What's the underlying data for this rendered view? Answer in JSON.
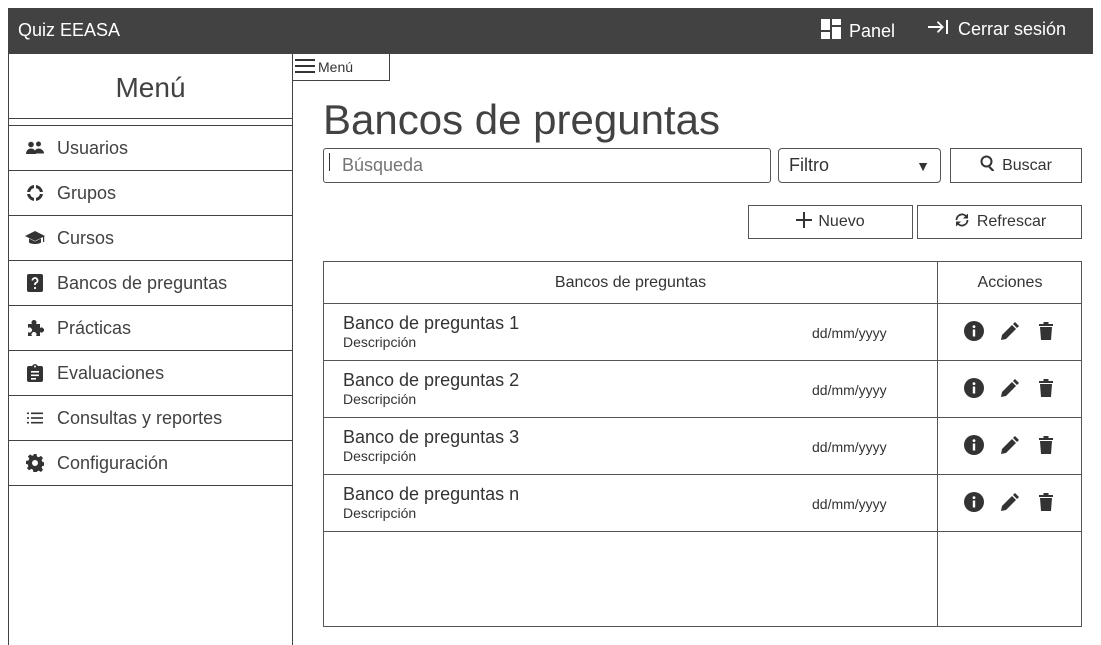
{
  "topbar": {
    "title": "Quiz EEASA",
    "panel_label": "Panel",
    "logout_label": "Cerrar sesión"
  },
  "sidebar": {
    "title": "Menú",
    "items": [
      {
        "label": "Usuarios",
        "icon": "users-icon"
      },
      {
        "label": "Grupos",
        "icon": "groups-icon"
      },
      {
        "label": "Cursos",
        "icon": "graduation-cap-icon"
      },
      {
        "label": "Bancos de preguntas",
        "icon": "question-icon"
      },
      {
        "label": "Prácticas",
        "icon": "puzzle-icon"
      },
      {
        "label": "Evaluaciones",
        "icon": "clipboard-icon"
      },
      {
        "label": "Consultas y reportes",
        "icon": "list-icon"
      },
      {
        "label": "Configuración",
        "icon": "gear-icon"
      }
    ]
  },
  "menu_toggle": {
    "label": "Menú"
  },
  "main": {
    "title": "Bancos de preguntas",
    "search": {
      "placeholder": "Búsqueda"
    },
    "filter": {
      "selected": "Filtro"
    },
    "search_button": "Buscar",
    "new_button": "Nuevo",
    "refresh_button": "Refrescar"
  },
  "table": {
    "headers": [
      "Bancos de preguntas",
      "Acciones"
    ],
    "rows": [
      {
        "name": "Banco de preguntas 1",
        "description": "Descripción",
        "date": "dd/mm/yyyy"
      },
      {
        "name": "Banco de preguntas 2",
        "description": "Descripción",
        "date": "dd/mm/yyyy"
      },
      {
        "name": "Banco de preguntas 3",
        "description": "Descripción",
        "date": "dd/mm/yyyy"
      },
      {
        "name": "Banco de preguntas n",
        "description": "Descripción",
        "date": "dd/mm/yyyy"
      }
    ]
  },
  "colors": {
    "topbar_bg": "#424242",
    "border": "#555555"
  }
}
